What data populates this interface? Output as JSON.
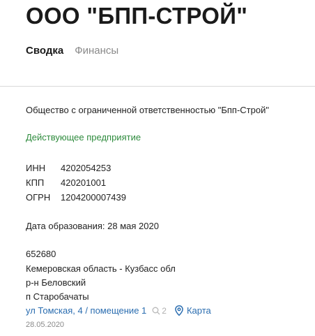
{
  "company": {
    "title": "ООО \"БПП-СТРОЙ\"",
    "full_name": "Общество с ограниченной ответственностью \"Бпп-Строй\"",
    "status": "Действующее предприятие"
  },
  "tabs": [
    {
      "label": "Сводка"
    },
    {
      "label": "Финансы"
    }
  ],
  "codes": [
    {
      "label": "ИНН",
      "value": "4202054253"
    },
    {
      "label": "КПП",
      "value": "420201001"
    },
    {
      "label": "ОГРН",
      "value": "1204200007439"
    }
  ],
  "founded": "Дата образования: 28 мая 2020",
  "address": {
    "postal_code": "652680",
    "region": "Кемеровская область - Кузбасс обл",
    "district": "р-н Беловский",
    "settlement": "п Старобачаты",
    "street_link": "ул Томская, 4 / помещение 1",
    "comments_count": "2",
    "map_label": "Карта",
    "date": "28.05.2020"
  },
  "colors": {
    "status_green": "#2e8b3d",
    "link_blue": "#2a6db0",
    "muted_gray": "#8a8a8a"
  }
}
